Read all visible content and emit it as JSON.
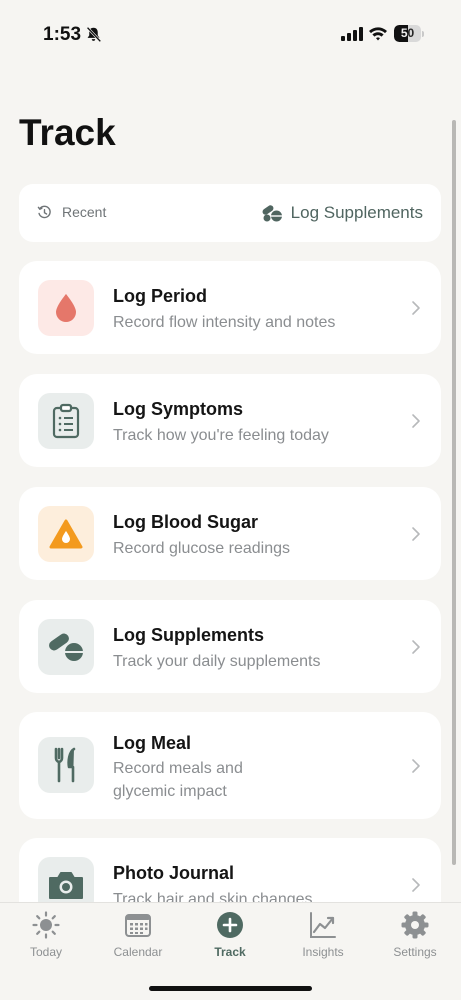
{
  "status": {
    "time": "1:53",
    "battery_level": "50",
    "battery_fraction": 0.5
  },
  "page": {
    "title": "Track"
  },
  "recent_bar": {
    "recent_label": "Recent",
    "quick_action_label": "Log Supplements"
  },
  "cards": [
    {
      "title": "Log Period",
      "subtitle": "Record flow intensity and notes",
      "icon": "drop-icon"
    },
    {
      "title": "Log Symptoms",
      "subtitle": "Track how you're feeling today",
      "icon": "clipboard-icon"
    },
    {
      "title": "Log Blood Sugar",
      "subtitle": "Record glucose readings",
      "icon": "warning-drop-icon"
    },
    {
      "title": "Log Supplements",
      "subtitle": "Track your daily supplements",
      "icon": "pills-icon"
    },
    {
      "title": "Log Meal",
      "subtitle": "Record meals and glycemic impact",
      "icon": "fork-knife-icon"
    },
    {
      "title": "Photo Journal",
      "subtitle": "Track hair and skin changes",
      "icon": "camera-icon"
    }
  ],
  "tabs": [
    {
      "label": "Today",
      "icon": "sun-icon"
    },
    {
      "label": "Calendar",
      "icon": "calendar-icon"
    },
    {
      "label": "Track",
      "icon": "plus-circle-icon",
      "active": true
    },
    {
      "label": "Insights",
      "icon": "chart-line-icon"
    },
    {
      "label": "Settings",
      "icon": "gear-icon"
    }
  ],
  "colors": {
    "background": "#f6f5f2",
    "accent": "#4f6a62",
    "period": "#e5776a",
    "sugar": "#f39a1e"
  }
}
